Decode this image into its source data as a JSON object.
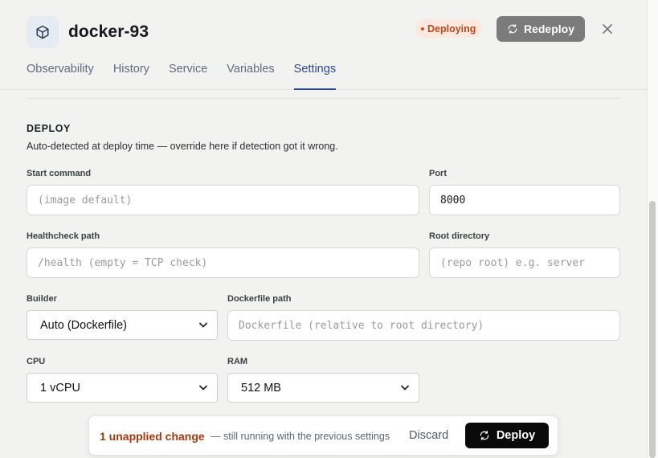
{
  "service": {
    "name": "docker-93",
    "icon": "box-icon"
  },
  "status": {
    "label": "Deploying",
    "color": "#c8561f"
  },
  "header": {
    "redeploy_label": "Redeploy"
  },
  "tabs": [
    {
      "label": "Observability"
    },
    {
      "label": "History"
    },
    {
      "label": "Service"
    },
    {
      "label": "Variables"
    },
    {
      "label": "Settings",
      "active": true
    }
  ],
  "deploy": {
    "title": "DEPLOY",
    "description": "Auto-detected at deploy time — override here if detection got it wrong.",
    "start_command": {
      "label": "Start command",
      "value": "",
      "placeholder": "(image default)"
    },
    "port": {
      "label": "Port",
      "value": "8000"
    },
    "healthcheck": {
      "label": "Healthcheck path",
      "value": "",
      "placeholder": "/health (empty = TCP check)"
    },
    "root_dir": {
      "label": "Root directory",
      "value": "",
      "placeholder": "(repo root) e.g. server"
    },
    "builder": {
      "label": "Builder",
      "selected": "Auto (Dockerfile)"
    },
    "dockerfile": {
      "label": "Dockerfile path",
      "value": "",
      "placeholder": "Dockerfile (relative to root directory)"
    },
    "cpu": {
      "label": "CPU",
      "selected": "1 vCPU"
    },
    "ram": {
      "label": "RAM",
      "selected": "512 MB"
    }
  },
  "changes": {
    "count_label": "1 unapplied change",
    "note": "— still running with the previous settings",
    "discard_label": "Discard",
    "deploy_label": "Deploy"
  },
  "colors": {
    "accent": "#2b4a8c",
    "warning": "#a8360f",
    "primary_button": "#0a0a0a"
  }
}
